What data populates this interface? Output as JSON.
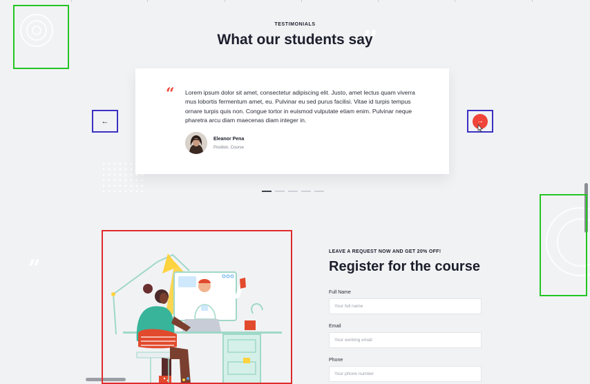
{
  "testimonials": {
    "eyebrow": "TESTIMONIALS",
    "title": "What our students say",
    "quote_mark": "“",
    "ghost_quote": "”",
    "quote": "Lorem ipsum dolor sit amet, consectetur adipiscing elit. Justo, amet lectus quam viverra mus lobortis fermentum amet, eu. Pulvinar eu sed purus facilisi. Vitae id turpis tempus ornare turpis quis non. Congue tortor in euismod vulputate etiam enim. Pulvinar neque pharetra arcu diam maecenas diam integer in.",
    "author_name": "Eleanor Pena",
    "author_role": "Position, Course",
    "prev_icon": "arrow-left-icon",
    "next_icon": "arrow-right-icon",
    "prev_glyph": "←",
    "next_glyph": "→",
    "slides": [
      {
        "active": true
      },
      {
        "active": false
      },
      {
        "active": false
      },
      {
        "active": false
      },
      {
        "active": false
      }
    ]
  },
  "register": {
    "eyebrow": "LEAVE A REQUEST NOW AND GET 20% OFF!",
    "title": "Register for the course",
    "fields": [
      {
        "label": "Full Name",
        "placeholder": "Your full name",
        "value": ""
      },
      {
        "label": "Email",
        "placeholder": "Your working email",
        "value": ""
      },
      {
        "label": "Phone",
        "placeholder": "Your phone number",
        "value": ""
      }
    ]
  },
  "colors": {
    "accent": "#f0443a",
    "background": "#f1f2f4",
    "heading": "#1b1e2b",
    "nav_highlight": "#3a2fc2",
    "illustration_highlight": "#e02b2b",
    "decor_highlight": "#22c522"
  }
}
